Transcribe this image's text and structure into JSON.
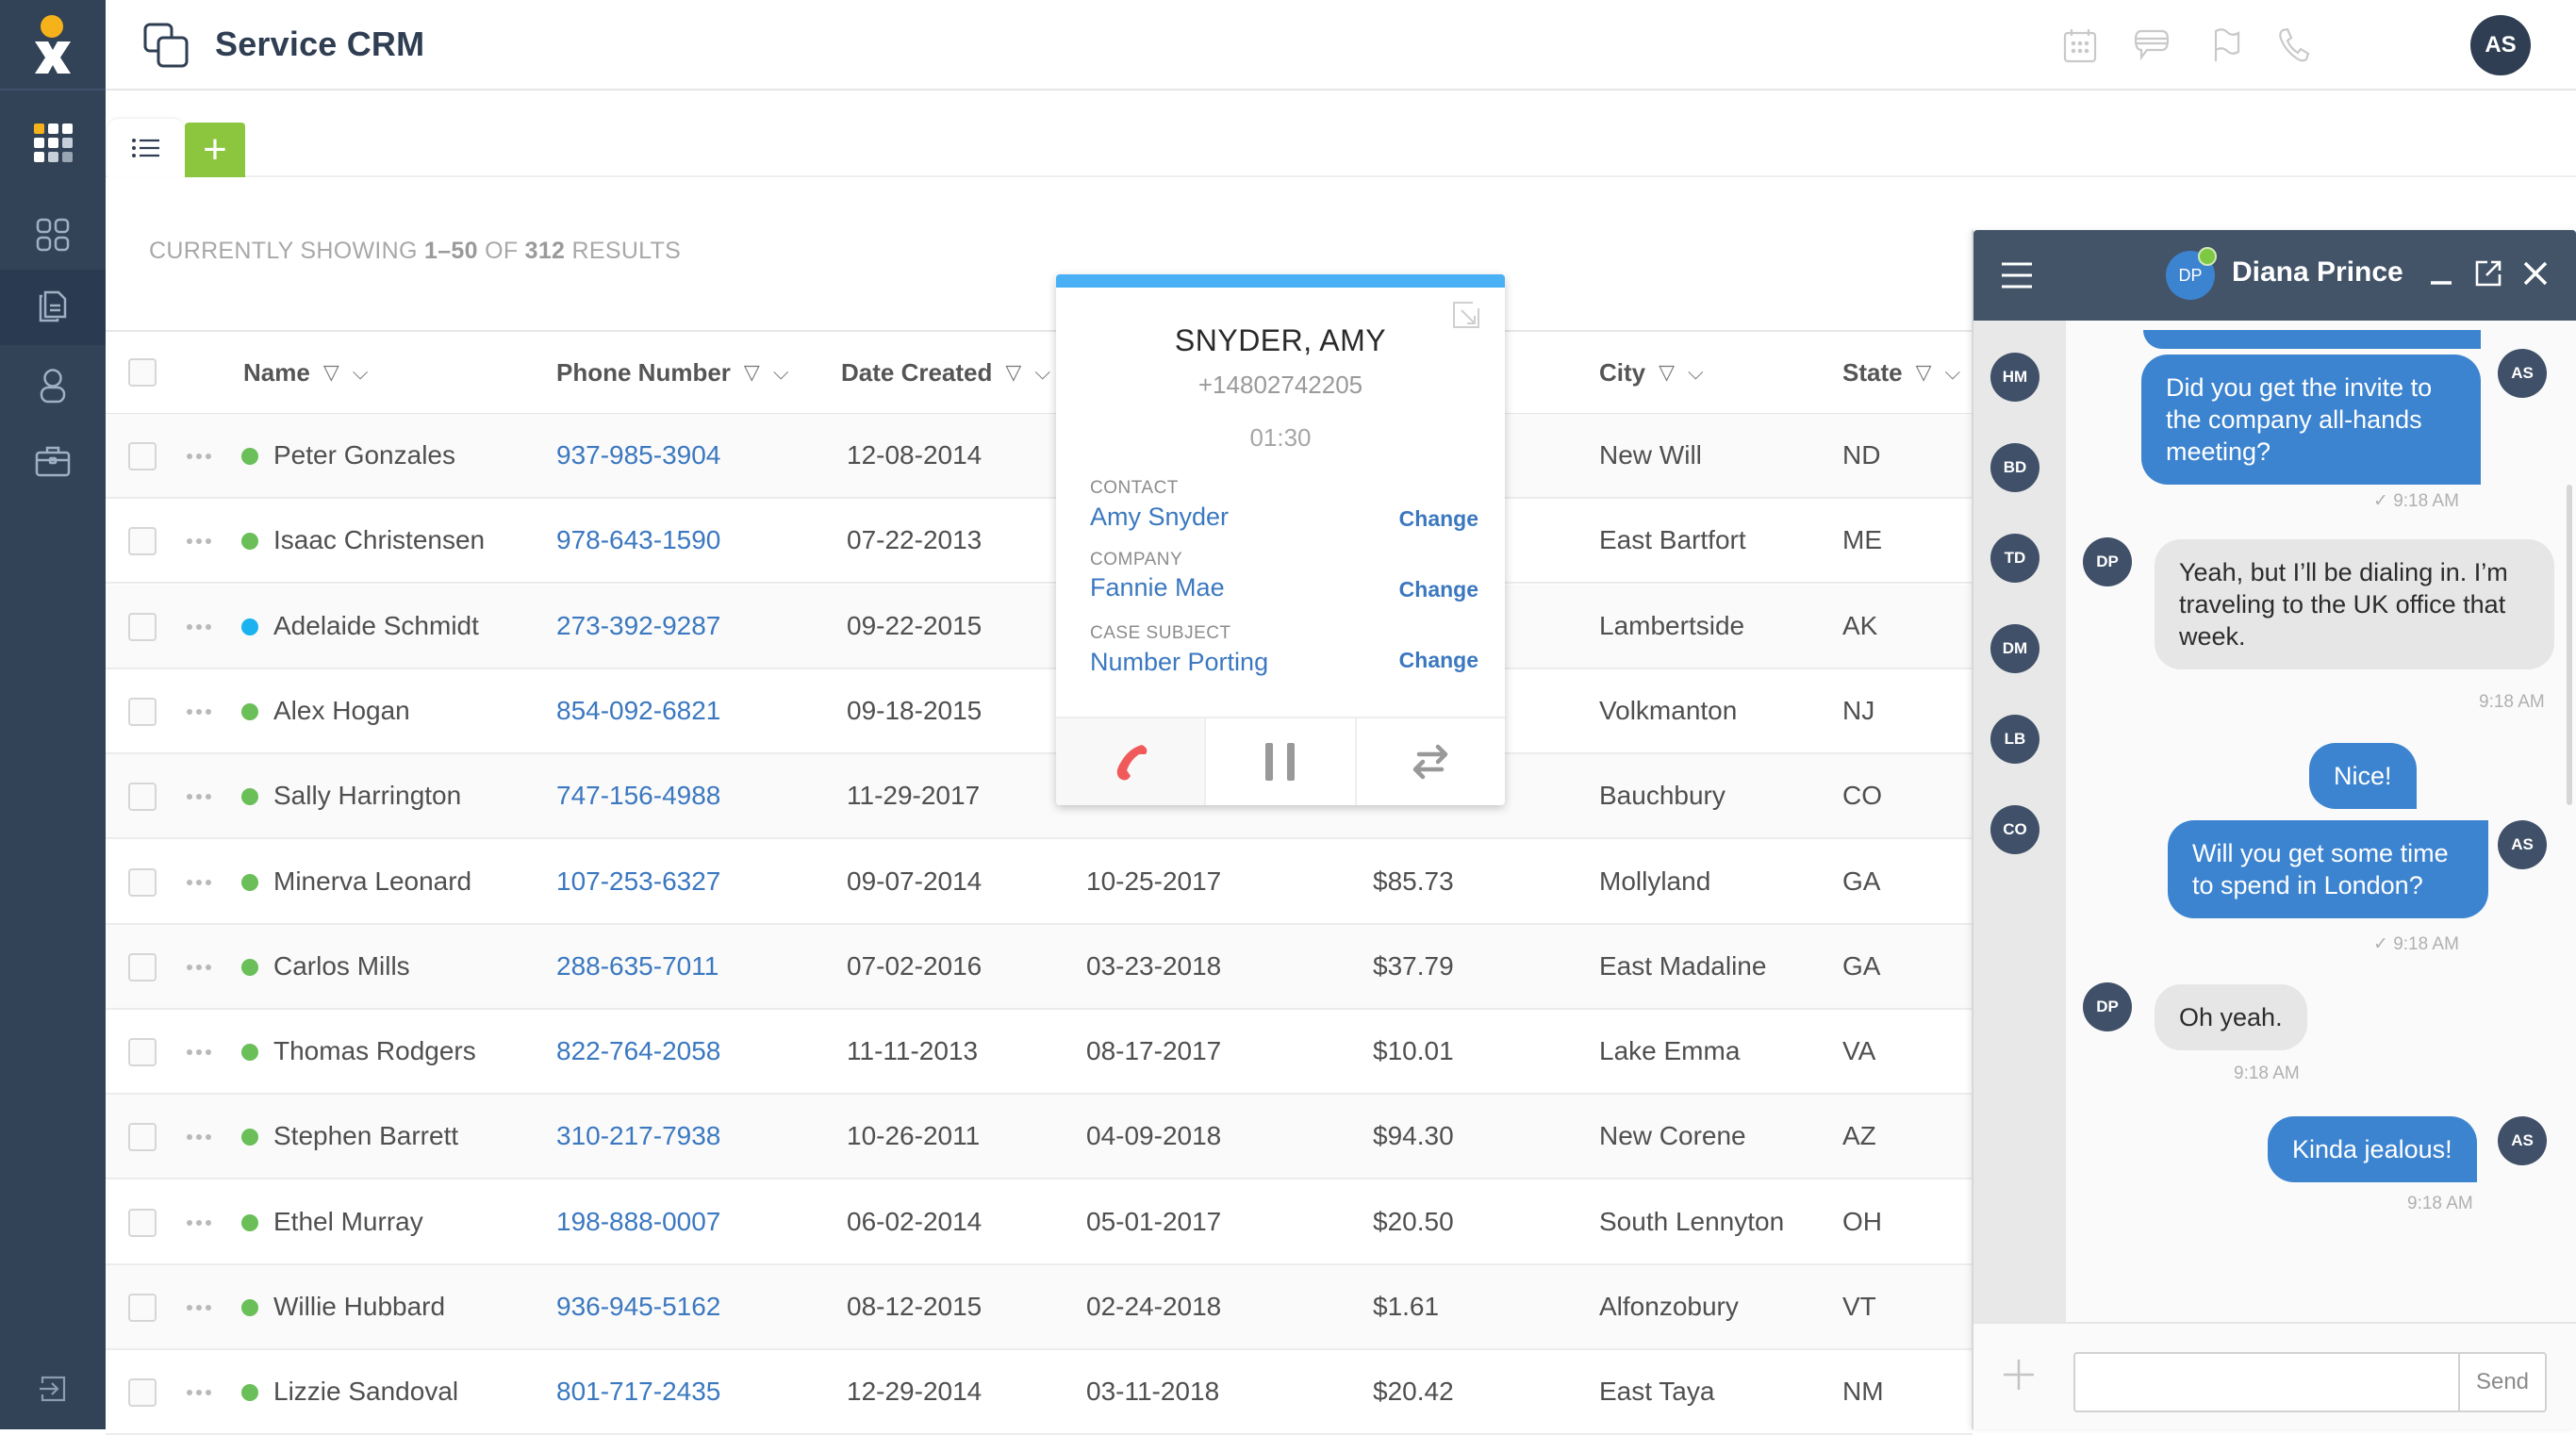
{
  "app": {
    "title": "Service CRM",
    "user_initials": "AS",
    "header_icons": [
      "calendar-icon",
      "chat-icon",
      "flag-icon",
      "phone-icon"
    ]
  },
  "sidebar": {
    "items": [
      {
        "name": "apps-grid",
        "icon": "grid-icon"
      },
      {
        "name": "dashboard",
        "icon": "dashboard-icon"
      },
      {
        "name": "cases",
        "icon": "documents-icon",
        "active": true
      },
      {
        "name": "contacts",
        "icon": "person-icon"
      },
      {
        "name": "companies",
        "icon": "briefcase-icon"
      }
    ],
    "footer_icon": "logout-icon"
  },
  "tabs": {
    "list_tab_icon": "list-icon",
    "add_label": "+"
  },
  "results": {
    "prefix": "CURRENTLY SHOWING ",
    "range": "1–50",
    "of": " OF ",
    "total": "312",
    "suffix": " RESULTS"
  },
  "table": {
    "columns": [
      {
        "label": "Name"
      },
      {
        "label": "Phone Number"
      },
      {
        "label": "Date Created"
      },
      {
        "label": "City"
      },
      {
        "label": "State"
      }
    ],
    "status_colors": {
      "green": "#6abf59",
      "blue": "#1ab2ef"
    },
    "rows": [
      {
        "name": "Peter Gonzales",
        "status": "green",
        "phone": "937-985-3904",
        "date_created": "12-08-2014",
        "date2": "",
        "amount": "",
        "city": "New Will",
        "state": "ND"
      },
      {
        "name": "Isaac Christensen",
        "status": "green",
        "phone": "978-643-1590",
        "date_created": "07-22-2013",
        "date2": "",
        "amount": "",
        "city": "East Bartfort",
        "state": "ME"
      },
      {
        "name": "Adelaide Schmidt",
        "status": "blue",
        "phone": "273-392-9287",
        "date_created": "09-22-2015",
        "date2": "",
        "amount": "",
        "city": "Lambertside",
        "state": "AK"
      },
      {
        "name": "Alex Hogan",
        "status": "green",
        "phone": "854-092-6821",
        "date_created": "09-18-2015",
        "date2": "",
        "amount": "",
        "city": "Volkmanton",
        "state": "NJ"
      },
      {
        "name": "Sally Harrington",
        "status": "green",
        "phone": "747-156-4988",
        "date_created": "11-29-2017",
        "date2": "",
        "amount": "",
        "city": "Bauchbury",
        "state": "CO"
      },
      {
        "name": "Minerva Leonard",
        "status": "green",
        "phone": "107-253-6327",
        "date_created": "09-07-2014",
        "date2": "10-25-2017",
        "amount": "$85.73",
        "city": "Mollyland",
        "state": "GA"
      },
      {
        "name": "Carlos Mills",
        "status": "green",
        "phone": "288-635-7011",
        "date_created": "07-02-2016",
        "date2": "03-23-2018",
        "amount": "$37.79",
        "city": "East Madaline",
        "state": "GA"
      },
      {
        "name": "Thomas Rodgers",
        "status": "green",
        "phone": "822-764-2058",
        "date_created": "11-11-2013",
        "date2": "08-17-2017",
        "amount": "$10.01",
        "city": "Lake Emma",
        "state": "VA"
      },
      {
        "name": "Stephen Barrett",
        "status": "green",
        "phone": "310-217-7938",
        "date_created": "10-26-2011",
        "date2": "04-09-2018",
        "amount": "$94.30",
        "city": "New Corene",
        "state": "AZ"
      },
      {
        "name": "Ethel Murray",
        "status": "green",
        "phone": "198-888-0007",
        "date_created": "06-02-2014",
        "date2": "05-01-2017",
        "amount": "$20.50",
        "city": "South Lennyton",
        "state": "OH"
      },
      {
        "name": "Willie Hubbard",
        "status": "green",
        "phone": "936-945-5162",
        "date_created": "08-12-2015",
        "date2": "02-24-2018",
        "amount": "$1.61",
        "city": "Alfonzobury",
        "state": "VT"
      },
      {
        "name": "Lizzie Sandoval",
        "status": "green",
        "phone": "801-717-2435",
        "date_created": "12-29-2014",
        "date2": "03-11-2018",
        "amount": "$20.42",
        "city": "East Taya",
        "state": "NM"
      }
    ]
  },
  "call": {
    "name": "SNYDER, AMY",
    "number": "+14802742205",
    "timer": "01:30",
    "fields": [
      {
        "label": "CONTACT",
        "value": "Amy Snyder",
        "action": "Change"
      },
      {
        "label": "COMPANY",
        "value": "Fannie Mae",
        "action": "Change"
      },
      {
        "label": "CASE SUBJECT",
        "value": "Number Porting",
        "action": "Change"
      }
    ],
    "accent": "#4ab0f5",
    "hangup_color": "#f05a5a"
  },
  "chat": {
    "contact_name": "Diana Prince",
    "contact_initials": "DP",
    "online": true,
    "rail_contacts": [
      "HM",
      "BD",
      "TD",
      "DM",
      "LB",
      "CO"
    ],
    "messages": [
      {
        "from": "me",
        "initials": "AS",
        "text": "Did you get the invite to the company all-hands meeting?",
        "time": "9:18 AM",
        "read": true
      },
      {
        "from": "them",
        "initials": "DP",
        "text": "Yeah, but I’ll be dialing in. I’m traveling to the UK office that week.",
        "time": "9:18 AM"
      },
      {
        "from": "me",
        "initials": "",
        "text": "Nice!",
        "time": ""
      },
      {
        "from": "me",
        "initials": "AS",
        "text": "Will you get some time to spend in London?",
        "time": "9:18 AM",
        "read": true
      },
      {
        "from": "them",
        "initials": "DP",
        "text": "Oh yeah.",
        "time": "9:18 AM"
      },
      {
        "from": "me",
        "initials": "AS",
        "text": "Kinda jealous!",
        "time": "9:18 AM"
      }
    ],
    "input_value": "",
    "input_placeholder": "",
    "send_label": "Send",
    "bubble_color": "#3d84d0"
  }
}
